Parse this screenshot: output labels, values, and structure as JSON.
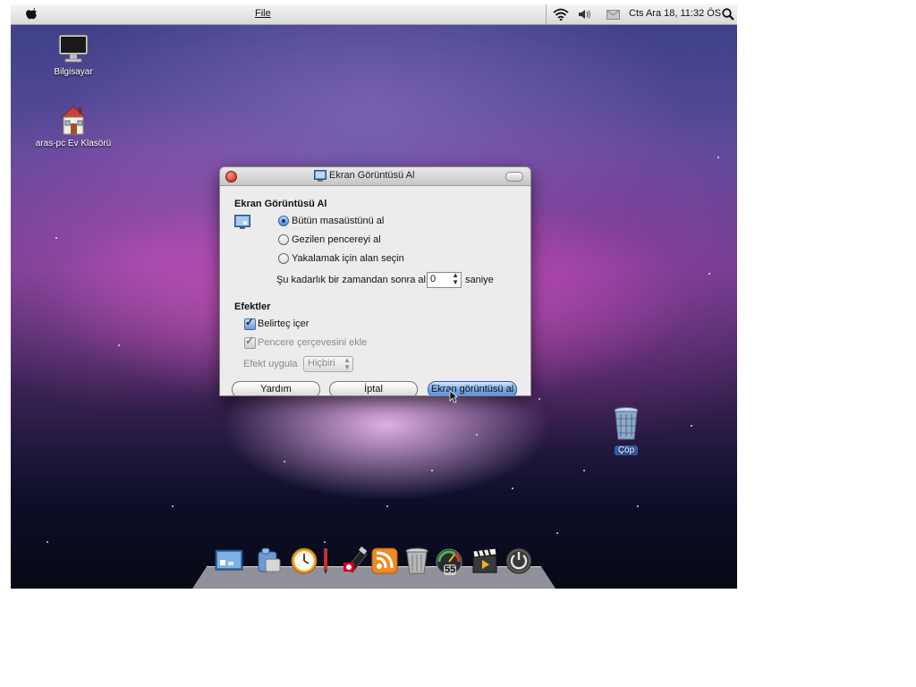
{
  "menubar": {
    "app_menu": "File",
    "datetime": "Cts Ara 18, 11:32 ÖS"
  },
  "desktop": {
    "icons": [
      {
        "label": "Bilgisayar"
      },
      {
        "label": "aras-pc Ev Klasörü"
      },
      {
        "label": "Çöp"
      }
    ]
  },
  "dialog": {
    "title": "Ekran Görüntüsü Al",
    "section1_title": "Ekran Görüntüsü Al",
    "radio_options": [
      {
        "label": "Bütün masaüstünü al",
        "selected": true
      },
      {
        "label": "Gezilen pencereyi al",
        "selected": false
      },
      {
        "label": "Yakalamak için alan seçin",
        "selected": false
      }
    ],
    "delay_label": "Şu kadarlık bir zamandan sonra al:",
    "delay_value": "0",
    "delay_unit": "saniye",
    "section2_title": "Efektler",
    "checkbox_pointer": {
      "label": "Belirteç içer",
      "checked": true
    },
    "checkbox_border": {
      "label": "Pencere çerçevesini ekle",
      "checked": true,
      "disabled": true
    },
    "effect_label": "Efekt uygula",
    "effect_value": "Hiçbiri",
    "buttons": {
      "help": "Yardım",
      "cancel": "İptal",
      "take": "Ekran görüntüsü al"
    }
  },
  "dock": {
    "items": [
      "screen-icon",
      "finder-icon",
      "clock-icon",
      "pen-icon",
      "usb-icon",
      "rss-icon",
      "trash-icon",
      "speedometer-icon",
      "clapper-icon",
      "power-icon"
    ],
    "speed_label": "55"
  },
  "colors": {
    "accent": "#5a92dd",
    "close_button": "#d9463f"
  }
}
